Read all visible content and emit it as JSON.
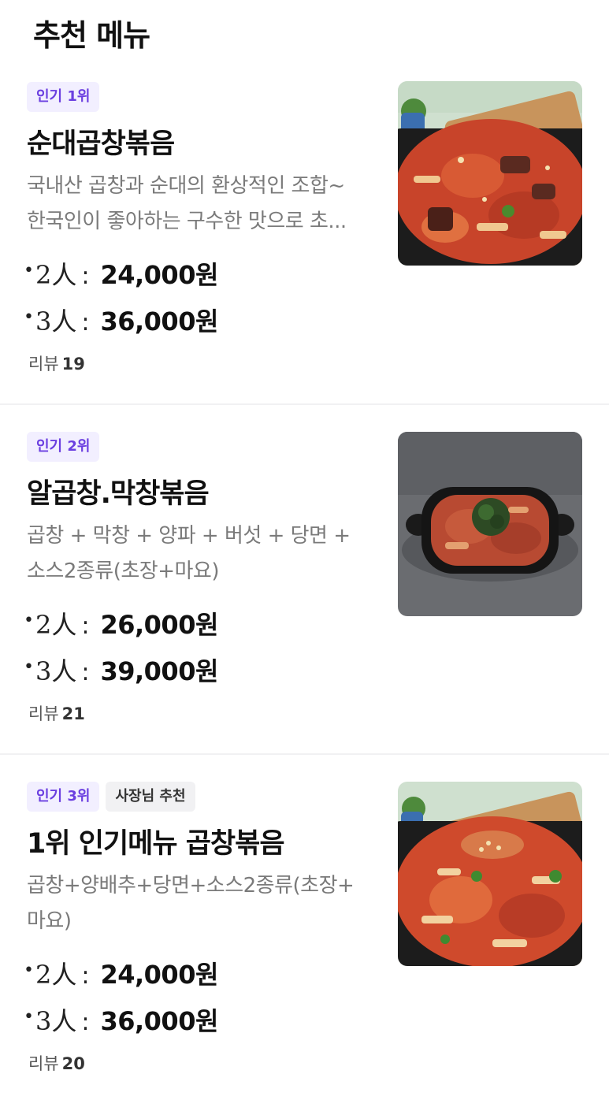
{
  "section_title": "추천 메뉴",
  "items": [
    {
      "badges": [
        "인기 1위"
      ],
      "name": "순대곱창볶음",
      "desc": [
        "국내산 곱창과 순대의 환상적인 조합~",
        "한국인이 좋아하는 구수한 맛으로 초..."
      ],
      "prices": [
        {
          "dot": "•",
          "size": "2人",
          "colon": ":",
          "amount": "24,000원"
        },
        {
          "dot": "•",
          "size": "3人",
          "colon": ":",
          "amount": "36,000원"
        }
      ],
      "review_label": "리뷰",
      "review_count": "19"
    },
    {
      "badges": [
        "인기 2위"
      ],
      "name": "알곱창.막창볶음",
      "desc": [
        "곱창 + 막창 + 양파 + 버섯 + 당면 +",
        "소스2종류(초장+마요)"
      ],
      "prices": [
        {
          "dot": "•",
          "size": "2人",
          "colon": ":",
          "amount": "26,000원"
        },
        {
          "dot": "•",
          "size": "3人",
          "colon": ":",
          "amount": "39,000원"
        }
      ],
      "review_label": "리뷰",
      "review_count": "21"
    },
    {
      "badges": [
        "인기 3위",
        "사장님 추천"
      ],
      "name": "1위 인기메뉴 곱창볶음",
      "desc": [
        "곱창+양배추+당면+소스2종류(초장+",
        "마요)"
      ],
      "prices": [
        {
          "dot": "•",
          "size": "2人",
          "colon": ":",
          "amount": "24,000원"
        },
        {
          "dot": "•",
          "size": "3人",
          "colon": ":",
          "amount": "36,000원"
        }
      ],
      "review_label": "리뷰",
      "review_count": "20"
    }
  ],
  "colors": {
    "rank_badge_bg": "#f2efff",
    "rank_badge_text": "#6b3fe0",
    "owner_badge_bg": "#f1f1f3",
    "desc_text": "#7a7a7a"
  }
}
